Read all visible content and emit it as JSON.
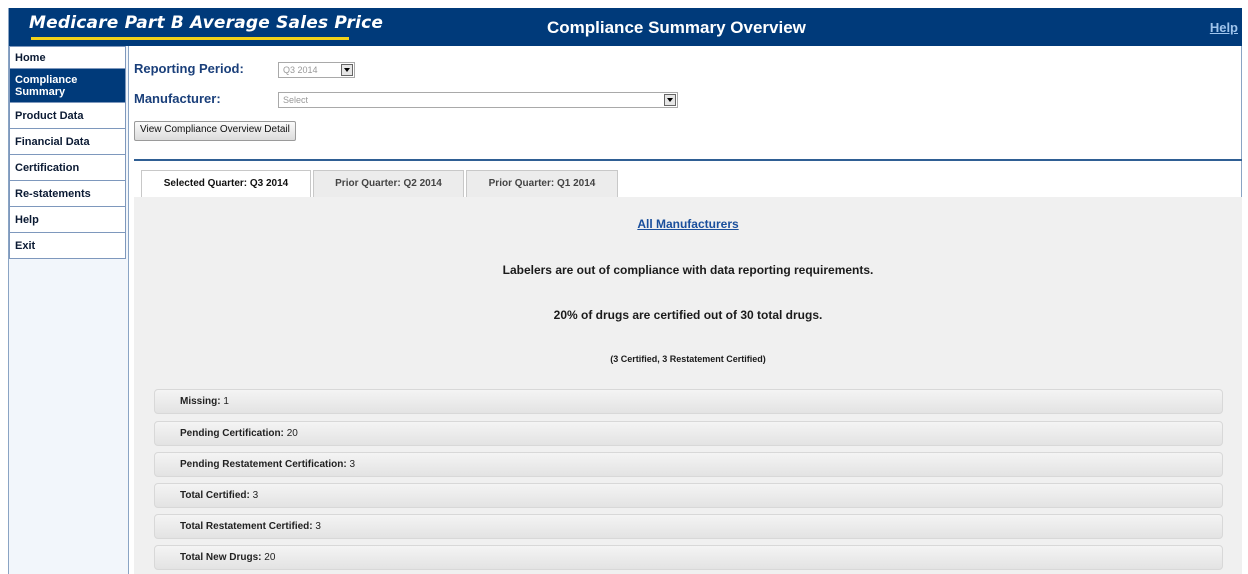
{
  "header": {
    "brand": "Medicare Part B Average Sales Price",
    "title": "Compliance Summary Overview",
    "help": "Help"
  },
  "sidebar": {
    "items": [
      {
        "label": "Home"
      },
      {
        "label": "Compliance Summary",
        "active": true
      },
      {
        "label": "Product Data"
      },
      {
        "label": "Financial Data"
      },
      {
        "label": "Certification"
      },
      {
        "label": "Re-statements"
      },
      {
        "label": "Help"
      },
      {
        "label": "Exit"
      }
    ]
  },
  "form": {
    "reporting_period_label": "Reporting Period:",
    "reporting_period_value": "Q3 2014",
    "manufacturer_label": "Manufacturer:",
    "manufacturer_value": "Select",
    "view_button": "View Compliance Overview Detail"
  },
  "tabs": [
    {
      "label": "Selected Quarter: Q3 2014",
      "active": true
    },
    {
      "label": "Prior Quarter: Q2 2014"
    },
    {
      "label": "Prior Quarter: Q1 2014"
    }
  ],
  "summary": {
    "manufacturer_link": "All Manufacturers",
    "compliance_message": "Labelers are out of compliance with data reporting requirements.",
    "certified_message": "20% of drugs are certified out of 30 total drugs.",
    "certified_detail": "(3 Certified, 3 Restatement Certified)",
    "rows": [
      {
        "label": "Missing:",
        "value": "1"
      },
      {
        "label": "Pending Certification:",
        "value": "20"
      },
      {
        "label": "Pending Restatement Certification:",
        "value": "3"
      },
      {
        "label": "Total Certified:",
        "value": "3"
      },
      {
        "label": "Total Restatement Certified:",
        "value": "3"
      },
      {
        "label": "Total New Drugs:",
        "value": "20"
      }
    ]
  },
  "colors": {
    "header_bg": "#003a7a",
    "accent_underline": "#f2d21a",
    "label_blue": "#1a3f7a"
  }
}
